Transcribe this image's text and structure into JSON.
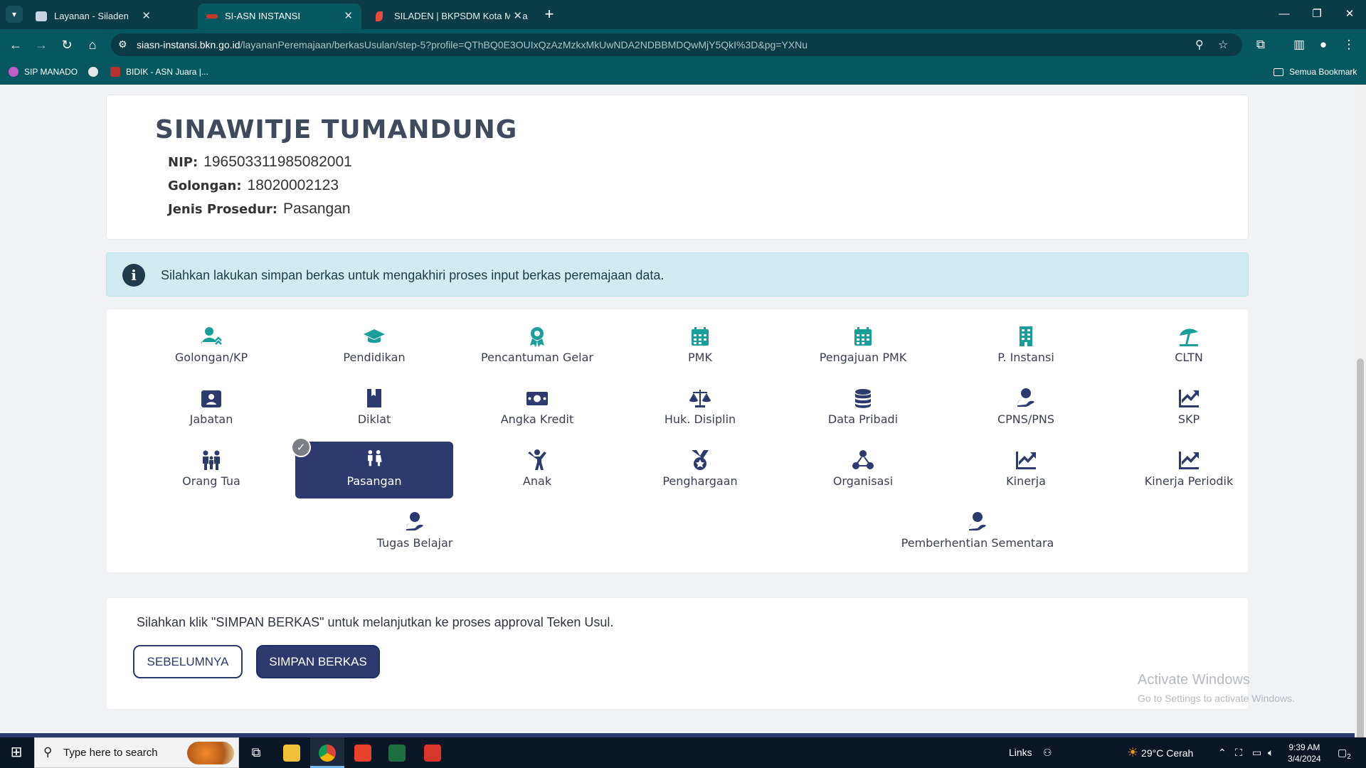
{
  "browser": {
    "tabs": [
      {
        "title": "Layanan - Siladen",
        "active": false
      },
      {
        "title": "SI-ASN INSTANSI",
        "active": true
      },
      {
        "title": "SILADEN | BKPSDM Kota Mana",
        "active": false
      }
    ],
    "url_host": "siasn-instansi.bkn.go.id",
    "url_path": "/layananPeremajaan/berkasUsulan/step-5?profile=QThBQ0E3OUIxQzAzMzkxMkUwNDA2NDBBMDQwMjY5QkI%3D&pg=YXNu",
    "bookmarks": [
      "SIP MANADO",
      "BIDIK - ASN Juara |...",
      "Semua Bookmark"
    ]
  },
  "profile": {
    "name": "SINAWITJE TUMANDUNG",
    "nip_label": "NIP:",
    "nip": "196503311985082001",
    "golongan_label": "Golongan:",
    "golongan": "18020002123",
    "prosedur_label": "Jenis Prosedur:",
    "prosedur": "Pasangan"
  },
  "alert": {
    "text": "Silahkan lakukan simpan berkas untuk mengakhiri proses input berkas peremajaan data."
  },
  "menu": {
    "items": [
      {
        "label": "Golongan/KP",
        "icon": "user-up-icon"
      },
      {
        "label": "Pendidikan",
        "icon": "graduation-cap-icon"
      },
      {
        "label": "Pencantuman Gelar",
        "icon": "award-icon"
      },
      {
        "label": "PMK",
        "icon": "calendar-icon"
      },
      {
        "label": "Pengajuan PMK",
        "icon": "calendar-icon"
      },
      {
        "label": "P. Instansi",
        "icon": "building-icon"
      },
      {
        "label": "CLTN",
        "icon": "umbrella-beach-icon"
      },
      {
        "label": "Jabatan",
        "icon": "id-badge-icon"
      },
      {
        "label": "Diklat",
        "icon": "book-icon"
      },
      {
        "label": "Angka Kredit",
        "icon": "money-icon"
      },
      {
        "label": "Huk. Disiplin",
        "icon": "balance-scale-icon"
      },
      {
        "label": "Data Pribadi",
        "icon": "database-icon"
      },
      {
        "label": "CPNS/PNS",
        "icon": "user-hand-icon"
      },
      {
        "label": "SKP",
        "icon": "chart-line-icon"
      },
      {
        "label": "Orang Tua",
        "icon": "family-icon"
      },
      {
        "label": "Pasangan",
        "icon": "couple-icon",
        "active": true
      },
      {
        "label": "Anak",
        "icon": "child-icon"
      },
      {
        "label": "Penghargaan",
        "icon": "medal-icon"
      },
      {
        "label": "Organisasi",
        "icon": "network-icon"
      },
      {
        "label": "Kinerja",
        "icon": "chart-line-icon"
      },
      {
        "label": "Kinerja Periodik",
        "icon": "chart-line-icon"
      },
      {
        "label": "Tugas Belajar",
        "icon": "user-hand-icon"
      },
      {
        "label": "Pemberhentian Sementara",
        "icon": "user-hand-icon"
      }
    ]
  },
  "actions": {
    "instruction": "Silahkan klik \"SIMPAN BERKAS\" untuk melanjutkan ke proses approval Teken Usul.",
    "prev_label": "SEBELUMNYA",
    "save_label": "SIMPAN BERKAS"
  },
  "watermark": {
    "title": "Activate Windows",
    "subtitle": "Go to Settings to activate Windows."
  },
  "taskbar": {
    "search_placeholder": "Type here to search",
    "links_label": "Links",
    "weather": "29°C  Cerah",
    "time": "9:39 AM",
    "date": "3/4/2024",
    "notifications": "2"
  },
  "colors": {
    "chrome_dark": "#0b3b46",
    "chrome": "#06575f",
    "menu_icon": "#1a9e9a",
    "menu_icon_dark": "#2c3a6e",
    "active_item": "#2c3a6e",
    "alert_bg": "#d1ecf1"
  }
}
